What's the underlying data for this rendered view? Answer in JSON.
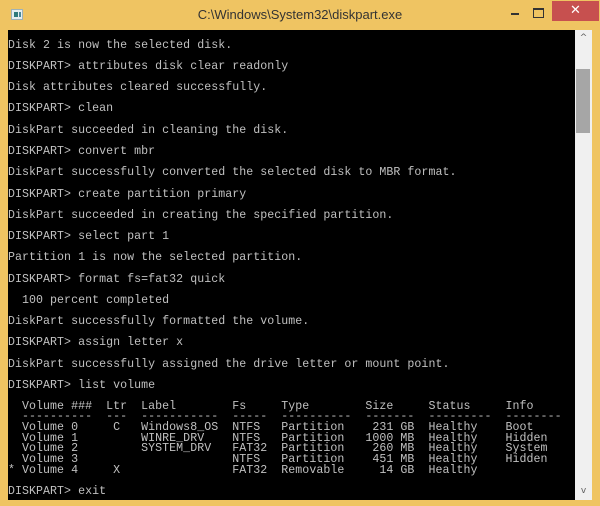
{
  "window": {
    "title": "C:\\Windows\\System32\\diskpart.exe",
    "icon": "console-app-icon",
    "controls": {
      "minimize": "–",
      "maximize": "□",
      "close": "✕"
    },
    "accent_color": "#efc462",
    "close_color": "#c7504f"
  },
  "console": {
    "background": "#000000",
    "foreground": "#c0c0c0",
    "lines": [
      "Disk 2 is now the selected disk.",
      "DISKPART> attributes disk clear readonly",
      "Disk attributes cleared successfully.",
      "DISKPART> clean",
      "DiskPart succeeded in cleaning the disk.",
      "DISKPART> convert mbr",
      "DiskPart successfully converted the selected disk to MBR format.",
      "DISKPART> create partition primary",
      "DiskPart succeeded in creating the specified partition.",
      "DISKPART> select part 1",
      "Partition 1 is now the selected partition.",
      "DISKPART> format fs=fat32 quick",
      "  100 percent completed",
      "DiskPart successfully formatted the volume.",
      "DISKPART> assign letter x",
      "DiskPart successfully assigned the drive letter or mount point.",
      "DISKPART> list volume"
    ],
    "volume_table": {
      "header": "  Volume ###  Ltr  Label        Fs     Type        Size     Status     Info",
      "separator": "  ----------  ---  -----------  -----  ----------  -------  ---------  --------",
      "columns": [
        "Volume ###",
        "Ltr",
        "Label",
        "Fs",
        "Type",
        "Size",
        "Status",
        "Info"
      ],
      "rows": [
        {
          "selected": false,
          "volume": "Volume 0",
          "ltr": "C",
          "label": "Windows8_OS",
          "fs": "NTFS",
          "type": "Partition",
          "size": "231 GB",
          "status": "Healthy",
          "info": "Boot"
        },
        {
          "selected": false,
          "volume": "Volume 1",
          "ltr": "",
          "label": "WINRE_DRV",
          "fs": "NTFS",
          "type": "Partition",
          "size": "1000 MB",
          "status": "Healthy",
          "info": "Hidden"
        },
        {
          "selected": false,
          "volume": "Volume 2",
          "ltr": "",
          "label": "SYSTEM_DRV",
          "fs": "FAT32",
          "type": "Partition",
          "size": "260 MB",
          "status": "Healthy",
          "info": "System"
        },
        {
          "selected": false,
          "volume": "Volume 3",
          "ltr": "",
          "label": "",
          "fs": "NTFS",
          "type": "Partition",
          "size": "451 MB",
          "status": "Healthy",
          "info": "Hidden"
        },
        {
          "selected": true,
          "volume": "Volume 4",
          "ltr": "X",
          "label": "",
          "fs": "FAT32",
          "type": "Removable",
          "size": "14 GB",
          "status": "Healthy",
          "info": ""
        }
      ],
      "row_text": [
        "  Volume 0     C   Windows8_OS  NTFS   Partition    231 GB  Healthy    Boot",
        "  Volume 1         WINRE_DRV    NTFS   Partition   1000 MB  Healthy    Hidden",
        "  Volume 2         SYSTEM_DRV   FAT32  Partition    260 MB  Healthy    System",
        "  Volume 3                      NTFS   Partition    451 MB  Healthy    Hidden",
        "* Volume 4     X                FAT32  Removable     14 GB  Healthy"
      ]
    },
    "final_prompt": "DISKPART> exit"
  },
  "scrollbar": {
    "up_arrow": "^",
    "down_arrow": "v"
  }
}
